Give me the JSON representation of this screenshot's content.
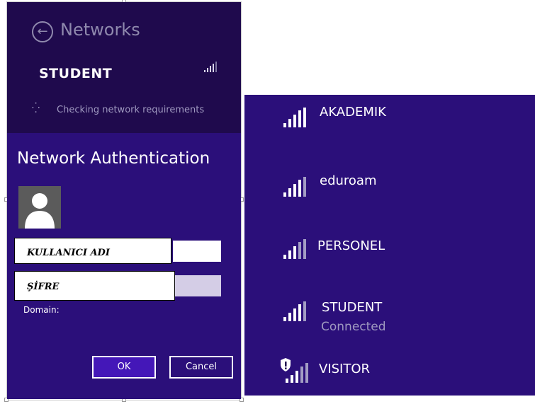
{
  "header": {
    "back_icon": "back-arrow-icon",
    "title": "Networks"
  },
  "selected_network": {
    "name": "STUDENT",
    "signal_icon": "signal-strength-icon"
  },
  "status": {
    "spinner_icon": "spinner-icon",
    "text": "Checking network requirements"
  },
  "auth": {
    "title": "Network Authentication",
    "avatar_icon": "user-avatar-icon",
    "username_label": "KULLANICI ADI",
    "username_value": "",
    "password_label": "ŞİFRE",
    "password_value": "",
    "domain_label": "Domain:",
    "ok_label": "OK",
    "cancel_label": "Cancel"
  },
  "networks": [
    {
      "name": "AKADEMIK",
      "status": "",
      "secured_warning": false
    },
    {
      "name": "eduroam",
      "status": "",
      "secured_warning": false
    },
    {
      "name": "PERSONEL",
      "status": "",
      "secured_warning": false
    },
    {
      "name": "STUDENT",
      "status": "Connected",
      "secured_warning": false
    },
    {
      "name": "VISITOR",
      "status": "",
      "secured_warning": true
    }
  ],
  "colors": {
    "panel_dark": "#1f0a4d",
    "panel_purple": "#2b0f7a",
    "ok_button": "#4417b8",
    "text_muted": "#9f99c0"
  }
}
